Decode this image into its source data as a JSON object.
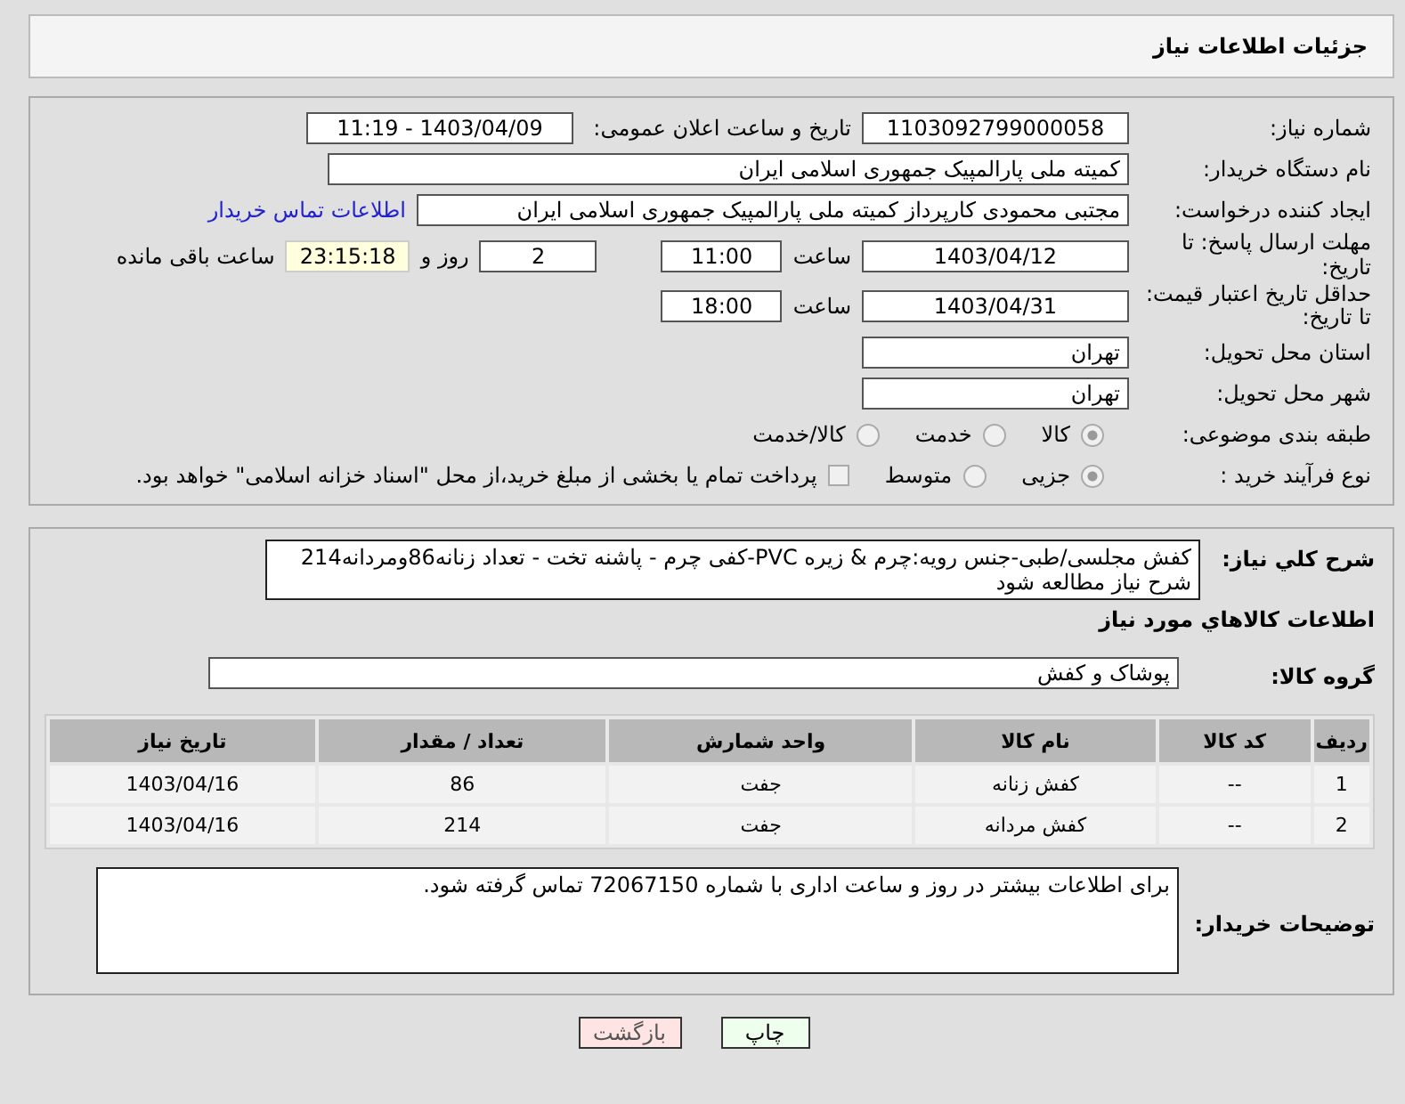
{
  "header": {
    "title": "جزئیات اطلاعات نیاز"
  },
  "need_number": {
    "label": "شماره نیاز:",
    "value": "1103092799000058"
  },
  "announce": {
    "label": "تاریخ و ساعت اعلان عمومی:",
    "value": "1403/04/09 - 11:19"
  },
  "buyer_org": {
    "label": "نام دستگاه خریدار:",
    "value": "کمیته ملی پارالمپیک جمهوری اسلامی ایران"
  },
  "requester": {
    "label": "ایجاد کننده درخواست:",
    "value": "مجتبی محمودی کارپرداز کمیته ملی پارالمپیک جمهوری اسلامی ایران",
    "link": "اطلاعات تماس خریدار"
  },
  "reply_deadline": {
    "label": "مهلت ارسال پاسخ: تا تاریخ:",
    "date": "1403/04/12",
    "time_label": "ساعت",
    "time": "11:00",
    "days": "2",
    "days_label": "روز و",
    "remaining": "23:15:18",
    "remaining_label": "ساعت باقی مانده"
  },
  "price_validity": {
    "label": "حداقل تاریخ اعتبار قیمت: تا تاریخ:",
    "date": "1403/04/31",
    "time_label": "ساعت",
    "time": "18:00"
  },
  "province": {
    "label": "استان محل تحویل:",
    "value": "تهران"
  },
  "city": {
    "label": "شهر محل تحویل:",
    "value": "تهران"
  },
  "category": {
    "label": "طبقه بندی موضوعی:",
    "options": [
      {
        "label": "کالا",
        "selected": true
      },
      {
        "label": "خدمت",
        "selected": false
      },
      {
        "label": "کالا/خدمت",
        "selected": false
      }
    ]
  },
  "purchase_type": {
    "label": "نوع فرآیند خرید :",
    "options": [
      {
        "label": "جزیی",
        "selected": true
      },
      {
        "label": "متوسط",
        "selected": false
      }
    ],
    "payment": {
      "checked": false,
      "label": "پرداخت تمام یا بخشی از مبلغ خرید،از محل \"اسناد خزانه اسلامی\" خواهد بود."
    }
  },
  "description": {
    "label": "شرح کلي نياز:",
    "value": "کفش مجلسی/طبی-جنس رویه:چرم & زیره PVC-کفی چرم - پاشنه تخت - تعداد زنانه86ومردانه214 شرح نیاز مطالعه شود"
  },
  "goods_heading": "اطلاعات کالاهاي مورد نياز",
  "goods_group": {
    "label": "گروه کالا:",
    "value": "پوشاک و کفش"
  },
  "table": {
    "columns": [
      "ردیف",
      "کد کالا",
      "نام کالا",
      "واحد شمارش",
      "تعداد / مقدار",
      "تاریخ نیاز"
    ],
    "rows": [
      [
        "1",
        "--",
        "کفش زنانه",
        "جفت",
        "86",
        "1403/04/16"
      ],
      [
        "2",
        "--",
        "کفش مردانه",
        "جفت",
        "214",
        "1403/04/16"
      ]
    ]
  },
  "buyer_notes": {
    "label": "توضیحات خریدار:",
    "value": "برای اطلاعات بیشتر در روز و ساعت اداری با شماره 72067150 تماس گرفته شود."
  },
  "buttons": [
    {
      "label": "چاپ",
      "kind": "print"
    },
    {
      "label": "بازگشت",
      "kind": "back"
    }
  ]
}
